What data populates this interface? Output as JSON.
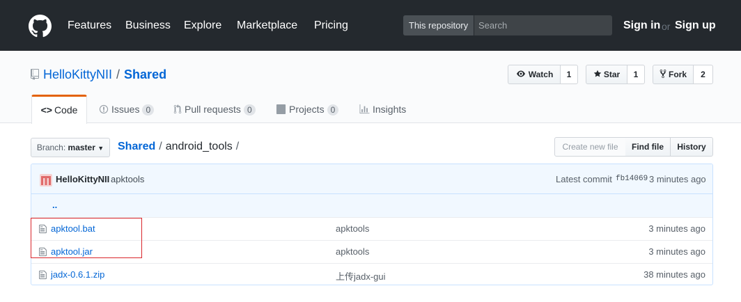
{
  "header": {
    "nav": [
      "Features",
      "Business",
      "Explore",
      "Marketplace",
      "Pricing"
    ],
    "search_scope": "This repository",
    "search_placeholder": "Search",
    "sign_in": "Sign in",
    "or": "or",
    "sign_up": "Sign up"
  },
  "repo": {
    "owner": "HelloKittyNII",
    "separator": "/",
    "name": "Shared",
    "watch_label": "Watch",
    "watch_count": "1",
    "star_label": "Star",
    "star_count": "1",
    "fork_label": "Fork",
    "fork_count": "2"
  },
  "tabs": [
    {
      "label": "Code"
    },
    {
      "label": "Issues",
      "count": "0"
    },
    {
      "label": "Pull requests",
      "count": "0"
    },
    {
      "label": "Projects",
      "count": "0"
    },
    {
      "label": "Insights"
    }
  ],
  "branch": {
    "prefix": "Branch:",
    "name": "master"
  },
  "breadcrumb": {
    "root": "Shared",
    "sep": "/",
    "dir": "android_tools",
    "trail": "/"
  },
  "file_buttons": {
    "create": "Create new file",
    "find": "Find file",
    "history": "History"
  },
  "commit": {
    "author": "HelloKittyNII",
    "message": "apktools",
    "latest_label": "Latest commit",
    "sha": "fb14069",
    "age": "3 minutes ago"
  },
  "parent_dir": "..",
  "files": [
    {
      "name": "apktool.bat",
      "message": "apktools",
      "age": "3 minutes ago"
    },
    {
      "name": "apktool.jar",
      "message": "apktools",
      "age": "3 minutes ago"
    },
    {
      "name": "jadx-0.6.1.zip",
      "message": "上传jadx-gui",
      "age": "38 minutes ago"
    }
  ],
  "colors": {
    "header_bg": "#24292e",
    "link": "#0366d6",
    "tab_accent": "#e36209",
    "highlight_box": "#d9252b"
  }
}
